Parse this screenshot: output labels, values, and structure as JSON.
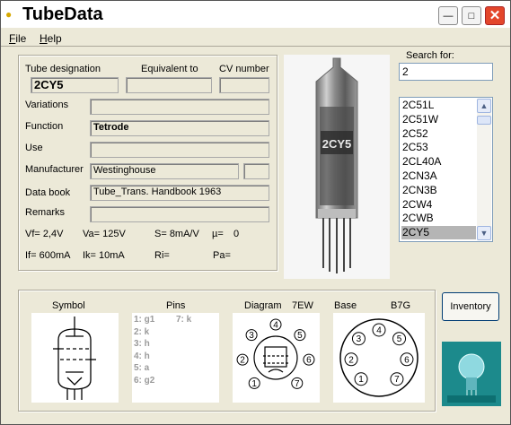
{
  "window": {
    "title": "TubeData"
  },
  "menu": [
    {
      "label": "File",
      "key": "F"
    },
    {
      "label": "Help",
      "key": "H"
    }
  ],
  "labels": {
    "tube_designation": "Tube designation",
    "equivalent_to": "Equivalent to",
    "cv_number": "CV number",
    "variations": "Variations",
    "function": "Function",
    "use": "Use",
    "manufacturer": "Manufacturer",
    "data_book": "Data book",
    "remarks": "Remarks"
  },
  "fields": {
    "tube_designation": "2CY5",
    "equivalent_to": "",
    "cv_number": "",
    "variations": "",
    "function": "Tetrode",
    "use": "",
    "manufacturer": "Westinghouse",
    "manufacturer_extra": "",
    "data_book": "Tube_Trans. Handbook 1963",
    "remarks": ""
  },
  "params": {
    "vf": "Vf= 2,4V",
    "va": "Va= 125V",
    "s": "S= 8mA/V",
    "mu": "µ=",
    "mu_value": "0",
    "if": "If= 600mA",
    "ik": "Ik= 10mA",
    "ri": "Ri=",
    "pa": "Pa="
  },
  "search": {
    "label": "Search for:",
    "value": "2"
  },
  "tube_list": {
    "items": [
      "2C51L",
      "2C51W",
      "2C52",
      "2C53",
      "2CL40A",
      "2CN3A",
      "2CN3B",
      "2CW4",
      "2CWB",
      "2CY5"
    ],
    "selected": "2CY5"
  },
  "photo": {
    "print": "2CY5"
  },
  "bottom": {
    "symbol_label": "Symbol",
    "pins_label": "Pins",
    "diagram_label": "Diagram",
    "diagram_code": "7EW",
    "base_label": "Base",
    "base_code": "B7G",
    "pins_col1": [
      "1: g1",
      "2: k",
      "3: h",
      "4: h",
      "5: a",
      "6: g2"
    ],
    "pins_col2": [
      "7: k"
    ],
    "diagram_pins": [
      "1",
      "2",
      "3",
      "4",
      "5",
      "6",
      "7"
    ],
    "base_pins": [
      "1",
      "2",
      "3",
      "4",
      "5",
      "6",
      "7"
    ]
  },
  "buttons": {
    "inventory": "Inventory"
  },
  "colors": {
    "window_bg": "#ece9d8",
    "close": "#e3462b",
    "selection": "#b5b5b5",
    "logo": "#1c8a8c"
  }
}
